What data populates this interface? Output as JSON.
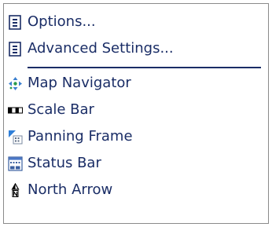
{
  "menu": {
    "items": [
      {
        "label": "Options...",
        "icon": "document-icon"
      },
      {
        "label": "Advanced Settings...",
        "icon": "document-icon"
      },
      {
        "label": "Map Navigator",
        "icon": "map-navigator-icon"
      },
      {
        "label": "Scale Bar",
        "icon": "scale-bar-icon"
      },
      {
        "label": "Panning Frame",
        "icon": "panning-frame-icon"
      },
      {
        "label": "Status Bar",
        "icon": "status-bar-icon"
      },
      {
        "label": "North Arrow",
        "icon": "north-arrow-icon"
      }
    ]
  },
  "colors": {
    "text": "#1a2d66",
    "separator": "#1a2d66",
    "border": "#8a8a8a",
    "background": "#ffffff"
  }
}
